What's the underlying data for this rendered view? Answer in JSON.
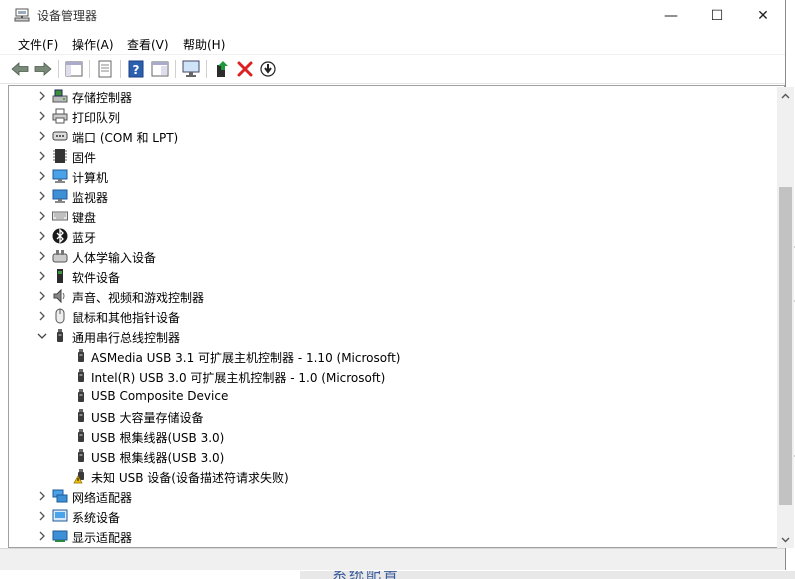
{
  "window": {
    "title": "设备管理器",
    "minimize_glyph": "—",
    "maximize_glyph": "☐",
    "close_glyph": "✕"
  },
  "menu": [
    "文件(F)",
    "操作(A)",
    "查看(V)",
    "帮助(H)"
  ],
  "toolbar": {
    "buttons": [
      "back-icon",
      "forward-icon",
      "console-tree-icon",
      "properties-icon",
      "help-icon",
      "view-icon",
      "scan-hardware-icon",
      "update-driver-icon",
      "uninstall-icon",
      "disable-device-icon"
    ]
  },
  "tree": [
    {
      "label": "存储控制器",
      "icon": "storage-controller-icon",
      "expanded": false,
      "level": 0
    },
    {
      "label": "打印队列",
      "icon": "printer-icon",
      "expanded": false,
      "level": 0
    },
    {
      "label": "端口 (COM 和 LPT)",
      "icon": "port-icon",
      "expanded": false,
      "level": 0
    },
    {
      "label": "固件",
      "icon": "firmware-icon",
      "expanded": false,
      "level": 0
    },
    {
      "label": "计算机",
      "icon": "computer-icon",
      "expanded": false,
      "level": 0
    },
    {
      "label": "监视器",
      "icon": "monitor-icon",
      "expanded": false,
      "level": 0
    },
    {
      "label": "键盘",
      "icon": "keyboard-icon",
      "expanded": false,
      "level": 0
    },
    {
      "label": "蓝牙",
      "icon": "bluetooth-icon",
      "expanded": false,
      "level": 0
    },
    {
      "label": "人体学输入设备",
      "icon": "hid-icon",
      "expanded": false,
      "level": 0
    },
    {
      "label": "软件设备",
      "icon": "software-device-icon",
      "expanded": false,
      "level": 0
    },
    {
      "label": "声音、视频和游戏控制器",
      "icon": "speaker-icon",
      "expanded": false,
      "level": 0
    },
    {
      "label": "鼠标和其他指针设备",
      "icon": "mouse-icon",
      "expanded": false,
      "level": 0
    },
    {
      "label": "通用串行总线控制器",
      "icon": "usb-icon",
      "expanded": true,
      "level": 0
    },
    {
      "label": "ASMedia USB 3.1 可扩展主机控制器 - 1.10 (Microsoft)",
      "icon": "usb-icon",
      "level": 1
    },
    {
      "label": "Intel(R) USB 3.0 可扩展主机控制器 - 1.0 (Microsoft)",
      "icon": "usb-icon",
      "level": 1
    },
    {
      "label": "USB Composite Device",
      "icon": "usb-icon",
      "level": 1
    },
    {
      "label": "USB 大容量存储设备",
      "icon": "usb-icon",
      "level": 1
    },
    {
      "label": "USB 根集线器(USB 3.0)",
      "icon": "usb-icon",
      "level": 1
    },
    {
      "label": "USB 根集线器(USB 3.0)",
      "icon": "usb-icon",
      "level": 1
    },
    {
      "label": "未知 USB 设备(设备描述符请求失败)",
      "icon": "usb-warning-icon",
      "level": 1
    },
    {
      "label": "网络适配器",
      "icon": "network-adapter-icon",
      "expanded": false,
      "level": 0
    },
    {
      "label": "系统设备",
      "icon": "system-device-icon",
      "expanded": false,
      "level": 0
    },
    {
      "label": "显示适配器",
      "icon": "display-adapter-icon",
      "expanded": false,
      "level": 0
    }
  ],
  "background": {
    "partial_text": "系统配置"
  },
  "colors": {
    "accent": "#1f6fc5",
    "warning": "#f2c200",
    "danger": "#d92323",
    "green": "#1e9a3c"
  }
}
